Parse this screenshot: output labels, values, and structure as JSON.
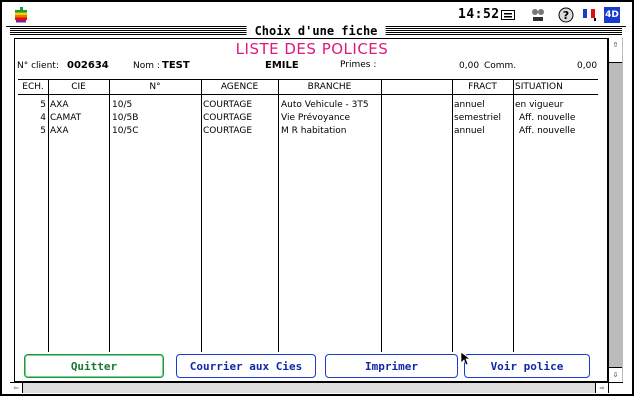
{
  "menubar": {
    "clock": "14:52",
    "icons": [
      "apple-icon",
      "keyboard-icon",
      "network-icon",
      "help-icon",
      "flag-icon",
      "4d-icon"
    ],
    "app_badge": "4D"
  },
  "window": {
    "title": "Choix d'une fiche"
  },
  "page": {
    "title": "LISTE DES POLICES",
    "client_label": "N° client:",
    "client_value": "002634",
    "nom_label": "Nom :",
    "nom_value": "TEST",
    "prenom_value": "EMILE",
    "primes_label": "Primes :",
    "primes_value": "0,00",
    "comm_label": "Comm.",
    "comm_value": "0,00"
  },
  "table": {
    "headers": [
      "ECH.",
      "CIE",
      "N°",
      "AGENCE",
      "BRANCHE",
      "",
      "FRACT",
      "SITUATION"
    ],
    "rows": [
      [
        "5",
        "AXA",
        "10/5",
        "COURTAGE",
        "Auto Vehicule - 3T5",
        "",
        "annuel",
        "en vigueur"
      ],
      [
        "4",
        "CAMAT",
        "10/5B",
        "COURTAGE",
        "Vie Prévoyance",
        "",
        "semestriel",
        "Aff. nouvelle"
      ],
      [
        "5",
        "AXA",
        "10/5C",
        "COURTAGE",
        "M R habitation",
        "",
        "annuel",
        "Aff. nouvelle"
      ]
    ]
  },
  "buttons": {
    "quit": "Quitter",
    "courrier": "Courrier aux Cies",
    "print": "Imprimer",
    "view": "Voir police"
  },
  "colors": {
    "title": "#e0177f",
    "quit": "#177a2e",
    "action": "#1028a8"
  }
}
